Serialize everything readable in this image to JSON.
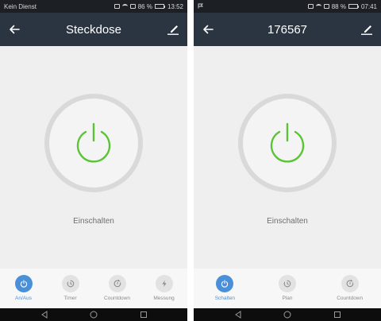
{
  "colors": {
    "power_green": "#5ac435",
    "active_blue": "#4a90d9",
    "header_bg": "#2b3542"
  },
  "screens": [
    {
      "status": {
        "left": "Kein Dienst",
        "battery": "86 %",
        "time": "13:52",
        "battery_level": 0.86
      },
      "header": {
        "title": "Steckdose",
        "back_icon": "arrow-left-icon",
        "edit_icon": "pencil-icon"
      },
      "power": {
        "label": "Einschalten",
        "icon": "power-icon"
      },
      "tabs": [
        {
          "label": "An/Aus",
          "icon": "power-icon",
          "active": true
        },
        {
          "label": "Timer",
          "icon": "timer-icon",
          "active": false
        },
        {
          "label": "Countdown",
          "icon": "countdown-icon",
          "active": false
        },
        {
          "label": "Messung",
          "icon": "lightning-icon",
          "active": false
        }
      ]
    },
    {
      "status": {
        "left": "",
        "battery": "88 %",
        "time": "07:41",
        "battery_level": 0.88
      },
      "header": {
        "title": "176567",
        "back_icon": "arrow-left-icon",
        "edit_icon": "pencil-icon"
      },
      "power": {
        "label": "Einschalten",
        "icon": "power-icon"
      },
      "tabs": [
        {
          "label": "Schalten",
          "icon": "power-icon",
          "active": true
        },
        {
          "label": "Plan",
          "icon": "timer-icon",
          "active": false
        },
        {
          "label": "Countdown",
          "icon": "countdown-icon",
          "active": false
        }
      ]
    }
  ],
  "system_nav": [
    "back-triangle-icon",
    "home-circle-icon",
    "recents-square-icon"
  ]
}
